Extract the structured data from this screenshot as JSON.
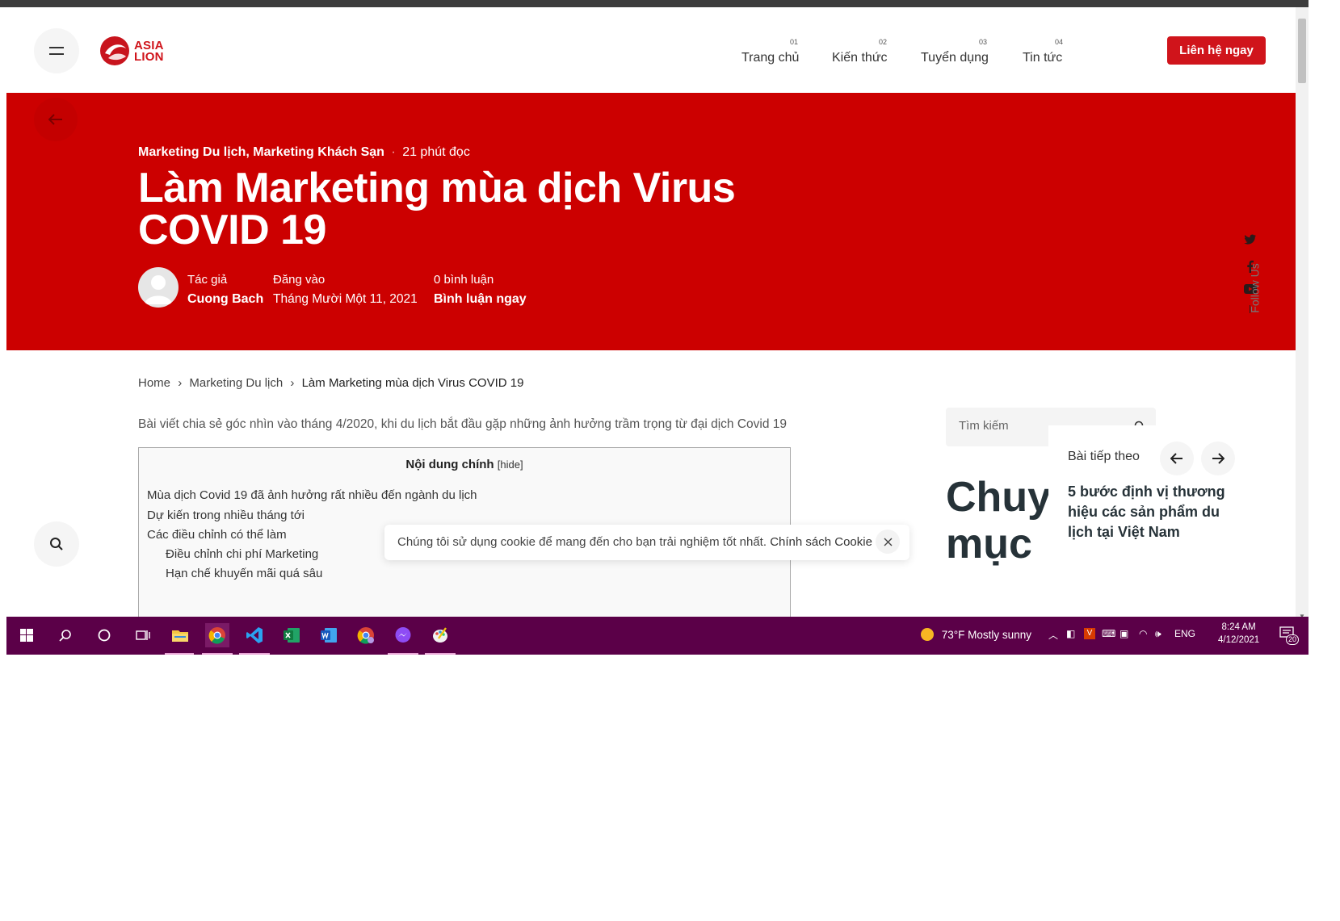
{
  "site": {
    "logo_text_line1": "ASIA",
    "logo_text_line2": "LION",
    "nav": [
      {
        "num": "01",
        "label": "Trang chủ"
      },
      {
        "num": "02",
        "label": "Kiến thức"
      },
      {
        "num": "03",
        "label": "Tuyển dụng"
      },
      {
        "num": "04",
        "label": "Tin tức"
      }
    ],
    "cta_label": "Liên hệ ngay",
    "brand_color": "#cc0000"
  },
  "hero": {
    "categories": "Marketing Du lịch, Marketing Khách Sạn",
    "read_time": "21 phút đọc",
    "title": "Làm Marketing mùa dịch Virus COVID 19",
    "author_label": "Tác giả",
    "author_name": "Cuong Bach",
    "posted_label": "Đăng vào",
    "posted_date": "Tháng Mười Một 11, 2021",
    "comments_count": "0 bình luận",
    "comment_cta": "Bình luận ngay",
    "follow_label": "Follow Us"
  },
  "breadcrumb": {
    "home": "Home",
    "category": "Marketing Du lịch",
    "current": "Làm Marketing mùa dịch Virus COVID 19"
  },
  "article": {
    "intro": "Bài viết chia sẻ góc nhìn vào tháng 4/2020, khi du lịch bắt đầu gặp những ảnh hưởng trầm trọng từ đại dịch Covid 19",
    "toc_title": "Nội dung chính",
    "toc_hide": "[hide]",
    "toc_items": [
      "Mùa dịch Covid 19 đã ảnh hưởng rất nhiều đến ngành du lịch",
      "Dự kiến trong nhiều tháng tới",
      "Các điều chỉnh có thể làm",
      "Điều chỉnh chi phí Marketing",
      "Hạn chế khuyến mãi quá sâu"
    ]
  },
  "sidebar": {
    "search_placeholder": "Tìm kiếm",
    "heading": "Chuyên mục",
    "heading_line1": "Chuy",
    "heading_line2": "mục",
    "next_label": "Bài tiếp theo",
    "next_title": "5 bước định vị thương hiệu các sản phẩm du lịch tại Việt Nam"
  },
  "cookie": {
    "text": "Chúng tôi sử dụng cookie để mang đến cho bạn trải nghiệm tốt nhất.",
    "policy_link": "Chính sách Cookie"
  },
  "taskbar": {
    "weather": "73°F  Mostly sunny",
    "language": "ENG",
    "time": "8:24 AM",
    "date": "4/12/2021",
    "notification_count": "20",
    "apps": [
      "start-icon",
      "search-icon",
      "cortana-icon",
      "task-view-icon",
      "file-explorer-icon",
      "chrome-icon",
      "vscode-icon",
      "excel-icon",
      "word-icon",
      "chrome-alt-icon",
      "messenger-icon",
      "paint-icon"
    ]
  }
}
